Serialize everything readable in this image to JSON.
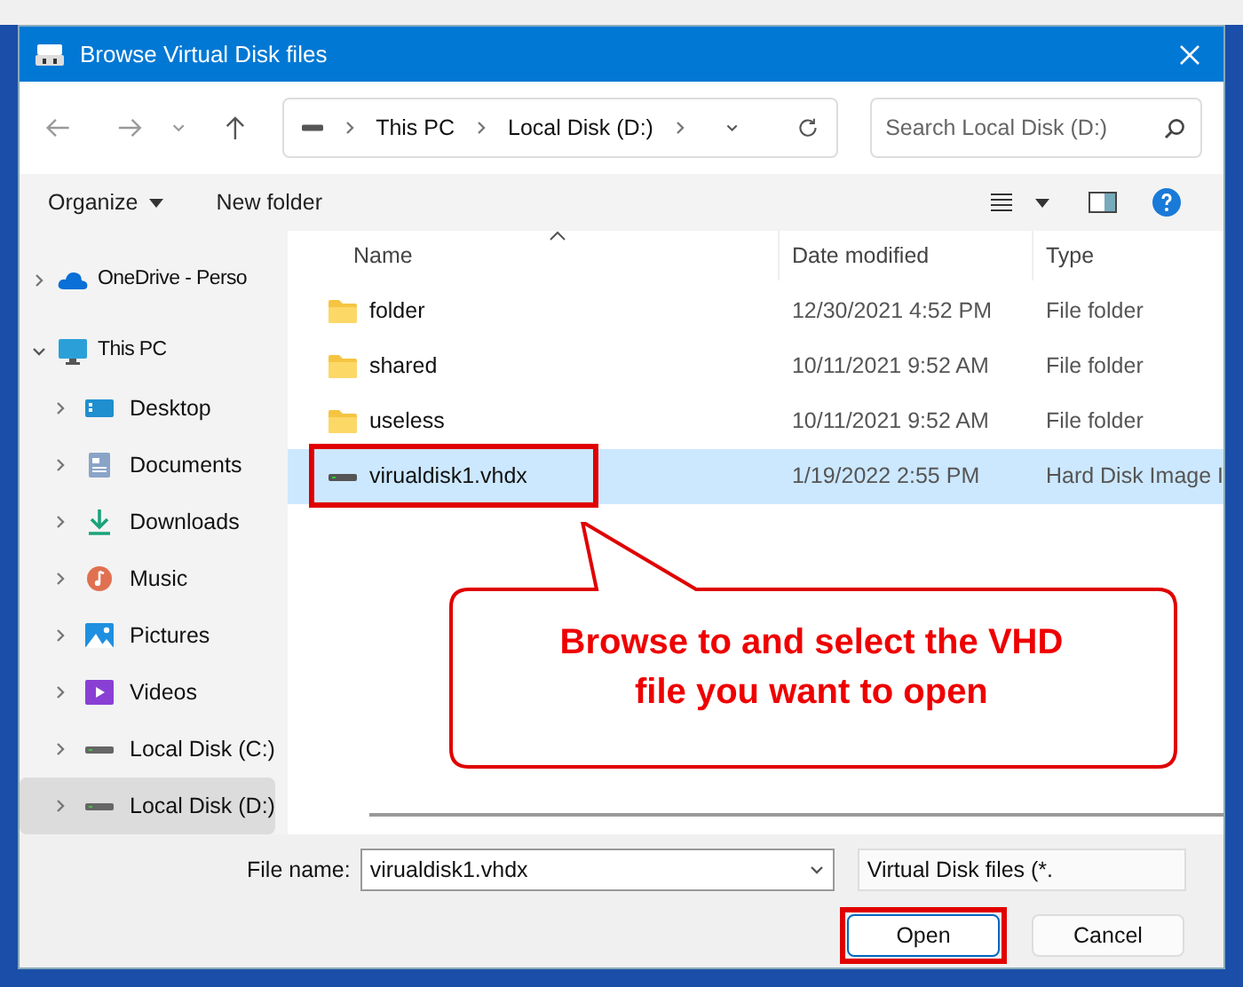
{
  "window": {
    "title": "Browse Virtual Disk files"
  },
  "address": {
    "crumbs": [
      "This PC",
      "Local Disk (D:)"
    ]
  },
  "search": {
    "placeholder": "Search Local Disk (D:)"
  },
  "toolbar": {
    "organize": "Organize",
    "new_folder": "New folder"
  },
  "sidebar": {
    "items": [
      {
        "label": "OneDrive - Perso",
        "kind": "cloud",
        "expanded": false,
        "selected": false
      },
      {
        "label": "This PC",
        "kind": "monitor",
        "expanded": true,
        "selected": false,
        "children": [
          {
            "label": "Desktop",
            "kind": "desktop",
            "expanded": false,
            "selected": false
          },
          {
            "label": "Documents",
            "kind": "documents",
            "expanded": false,
            "selected": false
          },
          {
            "label": "Downloads",
            "kind": "downloads",
            "expanded": false,
            "selected": false
          },
          {
            "label": "Music",
            "kind": "music",
            "expanded": false,
            "selected": false
          },
          {
            "label": "Pictures",
            "kind": "pictures",
            "expanded": false,
            "selected": false
          },
          {
            "label": "Videos",
            "kind": "videos",
            "expanded": false,
            "selected": false
          },
          {
            "label": "Local Disk (C:)",
            "kind": "drive",
            "expanded": false,
            "selected": false
          },
          {
            "label": "Local Disk (D:)",
            "kind": "drive",
            "expanded": false,
            "selected": true
          }
        ]
      }
    ]
  },
  "table": {
    "columns": [
      "Name",
      "Date modified",
      "Type"
    ],
    "rows": [
      {
        "kind": "folder",
        "name": "folder",
        "date": "12/30/2021 4:52 PM",
        "type": "File folder",
        "selected": false,
        "highlighted": false
      },
      {
        "kind": "folder",
        "name": "shared",
        "date": "10/11/2021 9:52 AM",
        "type": "File folder",
        "selected": false,
        "highlighted": false
      },
      {
        "kind": "folder",
        "name": "useless",
        "date": "10/11/2021 9:52 AM",
        "type": "File folder",
        "selected": false,
        "highlighted": false
      },
      {
        "kind": "disk",
        "name": "virualdisk1.vhdx",
        "date": "1/19/2022 2:55 PM",
        "type": "Hard Disk Image I",
        "selected": true,
        "highlighted": true
      }
    ]
  },
  "callout": {
    "text": "Browse to and select the VHD file you want to open"
  },
  "footer": {
    "file_name_label": "File name:",
    "file_name": "virualdisk1.vhdx",
    "filter": "Virtual Disk files (*.",
    "open": {
      "label": "Open",
      "highlighted": true
    },
    "cancel": {
      "label": "Cancel"
    }
  }
}
